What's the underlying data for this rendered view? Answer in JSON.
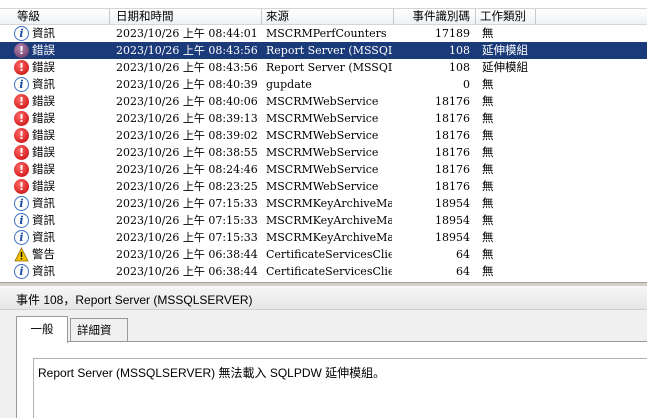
{
  "columns": {
    "level": "等級",
    "datetime": "日期和時間",
    "source": "來源",
    "event_id": "事件識別碼",
    "category": "工作類別"
  },
  "events": [
    {
      "level": "資訊",
      "icon": "info-icon",
      "datetime": "2023/10/26 上午 08:44:01",
      "source": "MSCRMPerfCounters",
      "event_id": "17189",
      "category": "無"
    },
    {
      "level": "錯誤",
      "icon": "error-icon",
      "datetime": "2023/10/26 上午 08:43:56",
      "source": "Report Server (MSSQL...",
      "event_id": "108",
      "category": "延伸模組",
      "selected": true
    },
    {
      "level": "錯誤",
      "icon": "error-icon",
      "datetime": "2023/10/26 上午 08:43:56",
      "source": "Report Server (MSSQL...",
      "event_id": "108",
      "category": "延伸模組"
    },
    {
      "level": "資訊",
      "icon": "info-icon",
      "datetime": "2023/10/26 上午 08:40:39",
      "source": "gupdate",
      "event_id": "0",
      "category": "無"
    },
    {
      "level": "錯誤",
      "icon": "error-icon",
      "datetime": "2023/10/26 上午 08:40:06",
      "source": "MSCRMWebService",
      "event_id": "18176",
      "category": "無"
    },
    {
      "level": "錯誤",
      "icon": "error-icon",
      "datetime": "2023/10/26 上午 08:39:13",
      "source": "MSCRMWebService",
      "event_id": "18176",
      "category": "無"
    },
    {
      "level": "錯誤",
      "icon": "error-icon",
      "datetime": "2023/10/26 上午 08:39:02",
      "source": "MSCRMWebService",
      "event_id": "18176",
      "category": "無"
    },
    {
      "level": "錯誤",
      "icon": "error-icon",
      "datetime": "2023/10/26 上午 08:38:55",
      "source": "MSCRMWebService",
      "event_id": "18176",
      "category": "無"
    },
    {
      "level": "錯誤",
      "icon": "error-icon",
      "datetime": "2023/10/26 上午 08:24:46",
      "source": "MSCRMWebService",
      "event_id": "18176",
      "category": "無"
    },
    {
      "level": "錯誤",
      "icon": "error-icon",
      "datetime": "2023/10/26 上午 08:23:25",
      "source": "MSCRMWebService",
      "event_id": "18176",
      "category": "無"
    },
    {
      "level": "資訊",
      "icon": "info-icon",
      "datetime": "2023/10/26 上午 07:15:33",
      "source": "MSCRMKeyArchiveMa...",
      "event_id": "18954",
      "category": "無"
    },
    {
      "level": "資訊",
      "icon": "info-icon",
      "datetime": "2023/10/26 上午 07:15:33",
      "source": "MSCRMKeyArchiveMa...",
      "event_id": "18954",
      "category": "無"
    },
    {
      "level": "資訊",
      "icon": "info-icon",
      "datetime": "2023/10/26 上午 07:15:33",
      "source": "MSCRMKeyArchiveMa...",
      "event_id": "18954",
      "category": "無"
    },
    {
      "level": "警告",
      "icon": "warning-icon",
      "datetime": "2023/10/26 上午 06:38:44",
      "source": "CertificateServicesClien...",
      "event_id": "64",
      "category": "無"
    },
    {
      "level": "資訊",
      "icon": "info-icon",
      "datetime": "2023/10/26 上午 06:38:44",
      "source": "CertificateServicesClien...",
      "event_id": "64",
      "category": "無"
    }
  ],
  "detail": {
    "title": "事件 108，Report Server (MSSQLSERVER)",
    "tabs": [
      "一般",
      "詳細資料"
    ],
    "message": "Report Server (MSSQLSERVER) 無法載入 SQLPDW 延伸模組。"
  },
  "colors": {
    "selection": "#1b3a79",
    "error": "#c40000",
    "info": "#1e4fa8",
    "warning": "#f2c200"
  }
}
